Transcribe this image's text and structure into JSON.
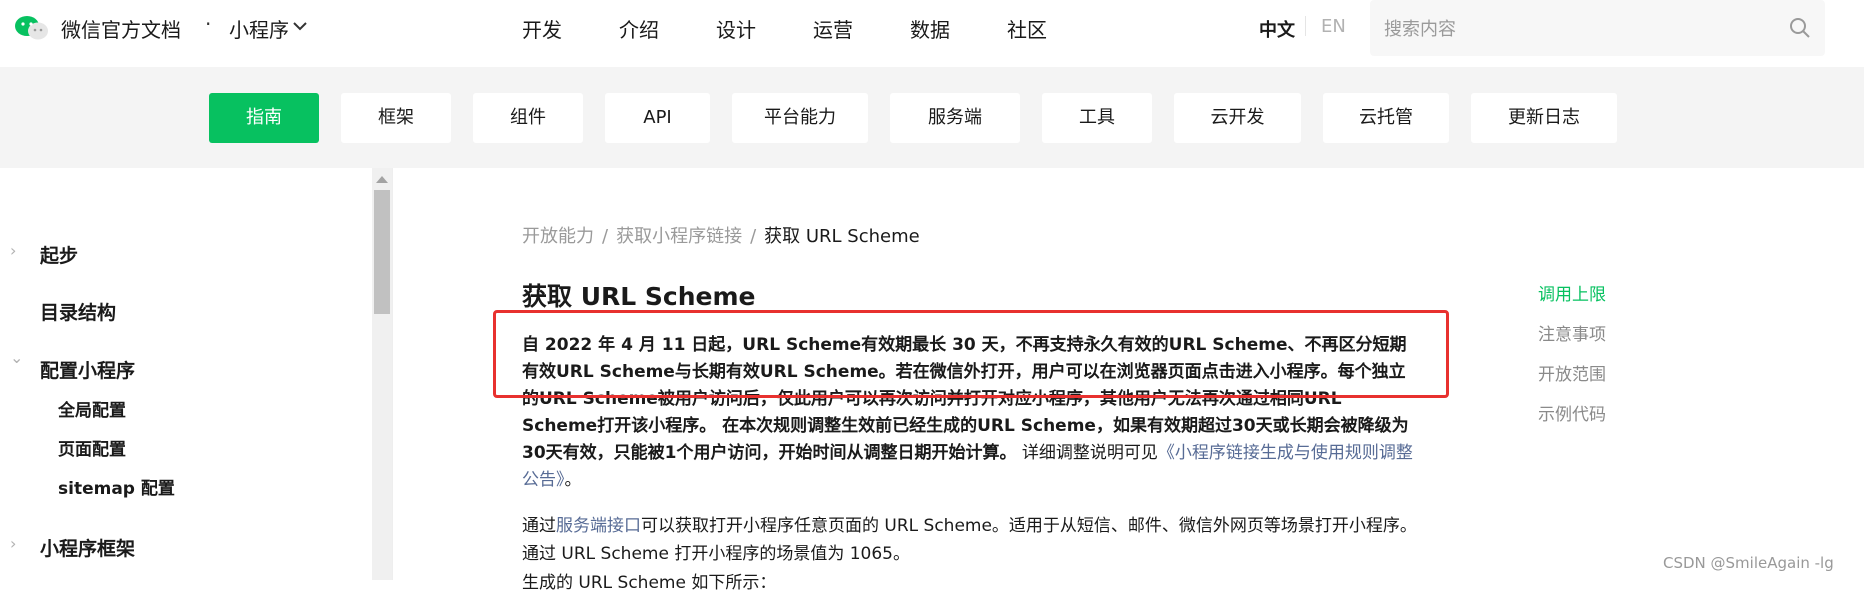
{
  "header": {
    "brand": "微信官方文档",
    "brand_dot": "·",
    "product": "小程序",
    "nav": [
      "开发",
      "介绍",
      "设计",
      "运营",
      "数据",
      "社区"
    ],
    "lang_cn": "中文",
    "lang_en": "EN",
    "search_placeholder": "搜索内容"
  },
  "subnav": {
    "items": [
      {
        "label": "指南",
        "width": 110,
        "active": true
      },
      {
        "label": "框架",
        "width": 110,
        "active": false
      },
      {
        "label": "组件",
        "width": 110,
        "active": false
      },
      {
        "label": "API",
        "width": 105,
        "active": false
      },
      {
        "label": "平台能力",
        "width": 136,
        "active": false
      },
      {
        "label": "服务端",
        "width": 130,
        "active": false
      },
      {
        "label": "工具",
        "width": 110,
        "active": false
      },
      {
        "label": "云开发",
        "width": 127,
        "active": false
      },
      {
        "label": "云托管",
        "width": 126,
        "active": false
      },
      {
        "label": "更新日志",
        "width": 146,
        "active": false
      }
    ]
  },
  "sidebar": {
    "items": [
      {
        "label": "起步",
        "arrow": "›"
      },
      {
        "label": "目录结构",
        "arrow": ""
      },
      {
        "label": "配置小程序",
        "arrow": "⌄"
      },
      {
        "label": "全局配置"
      },
      {
        "label": "页面配置"
      },
      {
        "label": "sitemap 配置"
      },
      {
        "label": "小程序框架",
        "arrow": "›"
      }
    ]
  },
  "breadcrumb": [
    "开放能力",
    "获取小程序链接",
    "获取 URL Scheme"
  ],
  "breadcrumb_sep": "/",
  "content": {
    "title": "获取 URL Scheme",
    "para1_bold": "自 2022 年 4 月 11 日起，URL Scheme有效期最长 30 天，不再支持永久有效的URL Scheme、不再区分短期有效URL Scheme与长期有效URL Scheme。若在微信外打开，用户可以在浏览器页面点击进入小程序。每个独立的URL Scheme被用户访问后，仅此用户可以再次访问并打开对应小程序，其他用户无法再次通过相同URL Scheme打开该小程序。 在本次规则调整生效前已经生成的URL Scheme，如果有效期超过30天或长期会被降级为30天有效，只能被1个用户访问，开始时间从调整日期开始计算。",
    "para1_normal": " 详细调整说明可见",
    "para1_link": "《小程序链接生成与使用规则调整公告》",
    "para1_end": "。",
    "para2_prefix": "通过",
    "para2_link": "服务端接口",
    "para2_rest": "可以获取打开小程序任意页面的 URL Scheme。适用于从短信、邮件、微信外网页等场景打开小程序。 通过 URL Scheme 打开小程序的场景值为 1065。",
    "para3": "生成的 URL Scheme 如下所示："
  },
  "toc": [
    "调用上限",
    "注意事项",
    "开放范围",
    "示例代码"
  ],
  "watermark": "CSDN @SmileAgain -lg",
  "colors": {
    "accent": "#07c160",
    "link": "#576b95",
    "highlight": "#e8312f"
  }
}
